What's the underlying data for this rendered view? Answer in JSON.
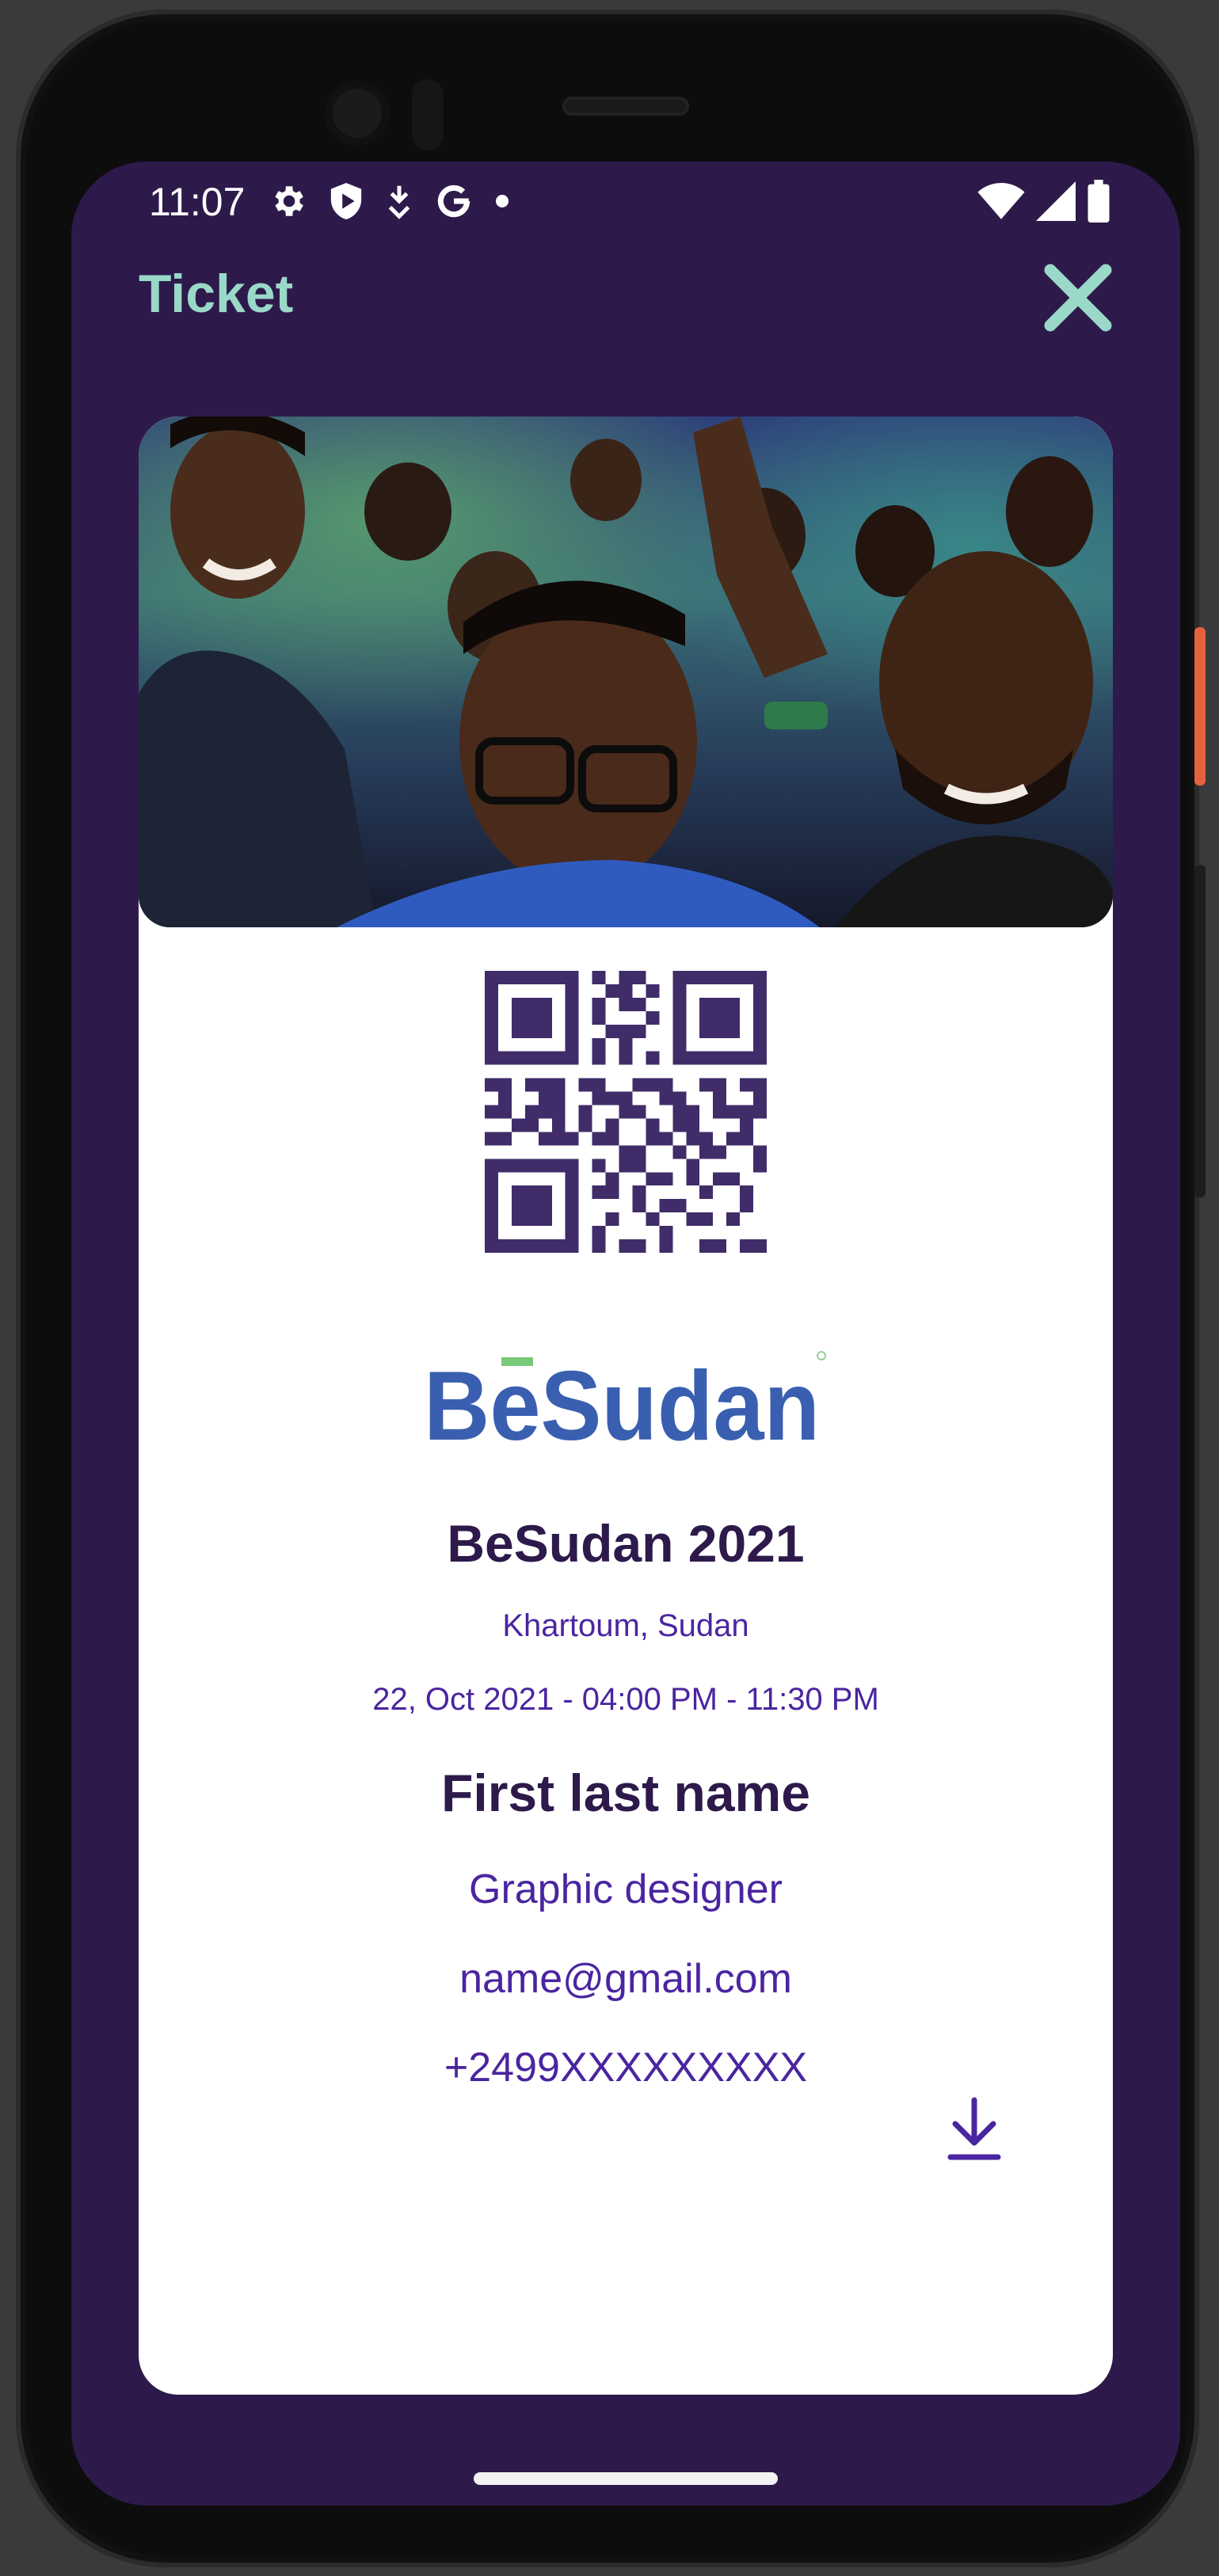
{
  "status_bar": {
    "time": "11:07",
    "left_icons": [
      "gear-icon",
      "shield-play-icon",
      "download-arrow-icon",
      "google-g-icon",
      "dot-icon"
    ],
    "right_icons": [
      "wifi-icon",
      "signal-icon",
      "battery-icon"
    ]
  },
  "appbar": {
    "title": "Ticket",
    "close_icon": "close-icon"
  },
  "ticket": {
    "hero_image": "crowd-photo",
    "qr_icon": "qr-code",
    "logo_text": "BeSudan",
    "event_title": "BeSudan 2021",
    "location": "Khartoum, Sudan",
    "datetime": "22, Oct 2021 - 04:00 PM - 11:30 PM",
    "attendee": {
      "name": "First last name",
      "role": "Graphic designer",
      "email": "name@gmail.com",
      "phone": "+2499XXXXXXXXX"
    },
    "download_icon": "download-icon"
  },
  "colors": {
    "screen_bg": "#2d1a4b",
    "accent_teal": "#9ad8c8",
    "text_dark": "#2d1a4b",
    "text_purple": "#4a25a0",
    "logo_blue": "#3a5fb0",
    "logo_green": "#7ac87a"
  }
}
